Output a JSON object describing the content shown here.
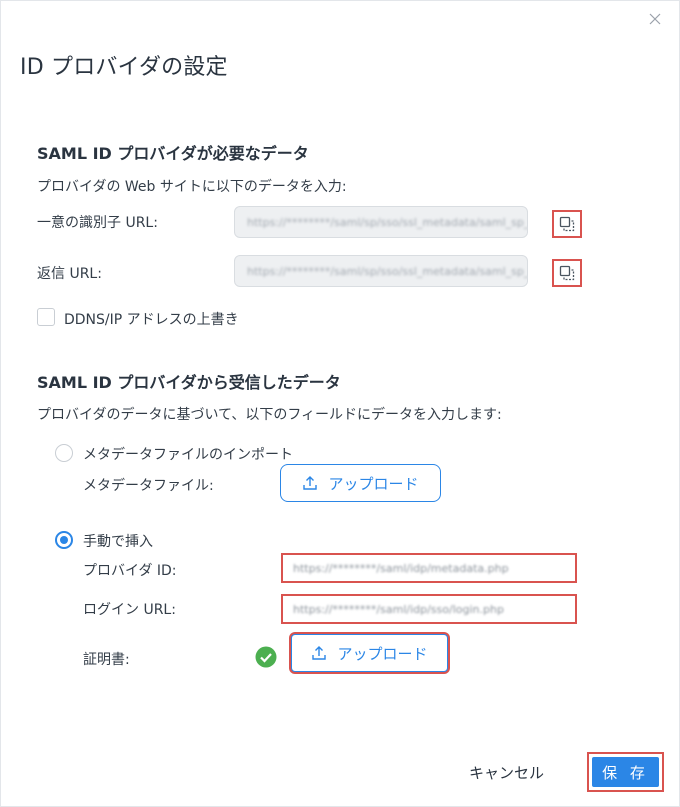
{
  "dialog": {
    "title": "ID プロバイダの設定",
    "close_icon": "close-icon"
  },
  "sp_section": {
    "title": "SAML ID プロバイダが必要なデータ",
    "description": "プロバイダの Web サイトに以下のデータを入力:",
    "entity_id_label": "一意の識別子 URL:",
    "entity_id_value": "https://********/saml/sp/sso/ssl_metadata/saml_sp_metadata.php",
    "reply_url_label": "返信 URL:",
    "reply_url_value": "https://********/saml/sp/sso/ssl_metadata/saml_sp_metadata.php",
    "copy_icon": "copy-icon",
    "ddns_override_label": "DDNS/IP アドレスの上書き",
    "ddns_override_checked": false
  },
  "idp_section": {
    "title": "SAML ID プロバイダから受信したデータ",
    "description": "プロバイダのデータに基づいて、以下のフィールドにデータを入力します:",
    "import_option_label": "メタデータファイルのインポート",
    "metadata_file_label": "メタデータファイル:",
    "upload_label": "アップロード",
    "upload_icon": "upload-icon",
    "manual_option_label": "手動で挿入",
    "manual_selected": true,
    "provider_id_label": "プロバイダ ID:",
    "provider_id_value": "https://********/saml/idp/metadata.php",
    "login_url_label": "ログイン URL:",
    "login_url_value": "https://********/saml/idp/sso/login.php",
    "certificate_label": "証明書:",
    "certificate_status_icon": "check-circle-icon"
  },
  "footer": {
    "cancel_label": "キャンセル",
    "save_label": "保 存"
  },
  "colors": {
    "accent": "#2b86e6",
    "highlight": "#d9534f",
    "success": "#4caf50"
  }
}
